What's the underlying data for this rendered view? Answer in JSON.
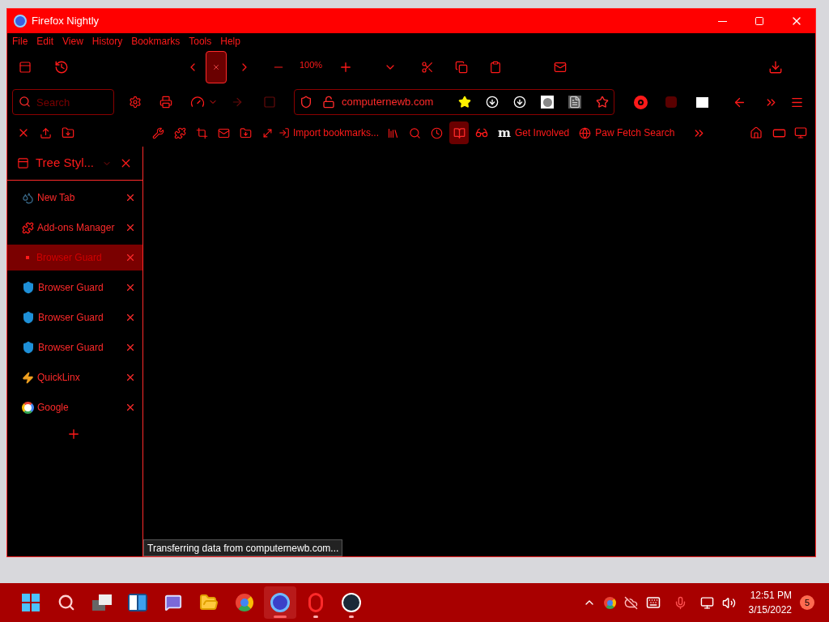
{
  "window": {
    "title": "Firefox Nightly"
  },
  "menu": [
    "File",
    "Edit",
    "View",
    "History",
    "Bookmarks",
    "Tools",
    "Help"
  ],
  "zoom": {
    "reading": "100%"
  },
  "search": {
    "placeholder": "Search"
  },
  "url": {
    "value": "computernewb.com"
  },
  "bookmarks": [
    {
      "kind": "import",
      "label": "Import bookmarks..."
    },
    {
      "kind": "letter",
      "glyph": "m",
      "label": "Get Involved"
    },
    {
      "kind": "globe",
      "label": "Paw Fetch Search"
    }
  ],
  "sidebar": {
    "title": "Tree Styl...",
    "tabs": [
      {
        "kind": "newtab",
        "label": "New Tab",
        "selected": false
      },
      {
        "kind": "addons",
        "label": "Add-ons Manager",
        "selected": false
      },
      {
        "kind": "dot",
        "label": "Browser Guard",
        "selected": true
      },
      {
        "kind": "shield",
        "label": "Browser Guard",
        "selected": false
      },
      {
        "kind": "shield",
        "label": "Browser Guard",
        "selected": false
      },
      {
        "kind": "shield",
        "label": "Browser Guard",
        "selected": false
      },
      {
        "kind": "bolt",
        "label": "QuickLinx",
        "selected": false
      },
      {
        "kind": "google",
        "label": "Google",
        "selected": false
      }
    ]
  },
  "status_bar": "Transferring data from computernewb.com...",
  "taskbar": {
    "apps": [
      {
        "kind": "start",
        "selected": false,
        "running": false
      },
      {
        "kind": "search",
        "selected": false,
        "running": false
      },
      {
        "kind": "taskview",
        "selected": false,
        "running": false
      },
      {
        "kind": "widgets",
        "selected": false,
        "running": false
      },
      {
        "kind": "chat",
        "selected": false,
        "running": false
      },
      {
        "kind": "explorer",
        "selected": false,
        "running": false
      },
      {
        "kind": "chrome",
        "selected": false,
        "running": false
      },
      {
        "kind": "firefox",
        "selected": true,
        "running": true
      },
      {
        "kind": "opera",
        "selected": false,
        "running": true
      },
      {
        "kind": "steam",
        "selected": false,
        "running": true
      }
    ],
    "time": "12:51 PM",
    "date": "3/15/2022",
    "notifications": "5"
  }
}
